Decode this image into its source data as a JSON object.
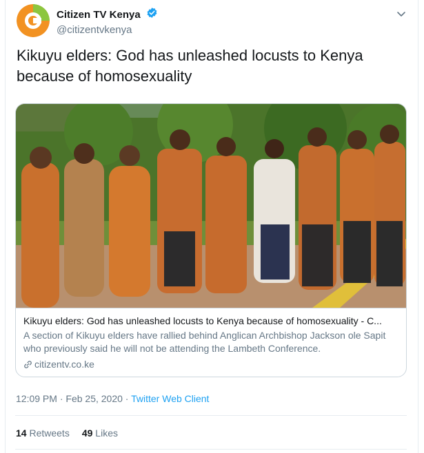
{
  "author": {
    "display_name": "Citizen TV Kenya",
    "handle": "@citizentvkenya",
    "verified": true,
    "avatar_colors": {
      "orange": "#f29222",
      "green": "#8cc63f"
    }
  },
  "tweet": {
    "text": "Kikuyu elders: God has unleashed locusts to Kenya because of homosexuality"
  },
  "card": {
    "title": "Kikuyu elders: God has unleashed locusts to Kenya because of homosexuality - C...",
    "description": "A section of Kikuyu elders have rallied behind Anglican Archbishop Jackson ole Sapit who previously said he will not be attending the Lambeth Conference.",
    "domain": "citizentv.co.ke",
    "image_icon": "photo-of-elders-group"
  },
  "meta": {
    "time": "12:09 PM",
    "separator1": " · ",
    "date": "Feb 25, 2020",
    "separator2": " · ",
    "source": "Twitter Web Client"
  },
  "stats": {
    "retweets_count": "14",
    "retweets_label": " Retweets",
    "likes_count": "49",
    "likes_label": " Likes"
  },
  "colors": {
    "link_blue": "#1da1f2",
    "muted": "#657786",
    "border": "#ccd6dd"
  }
}
